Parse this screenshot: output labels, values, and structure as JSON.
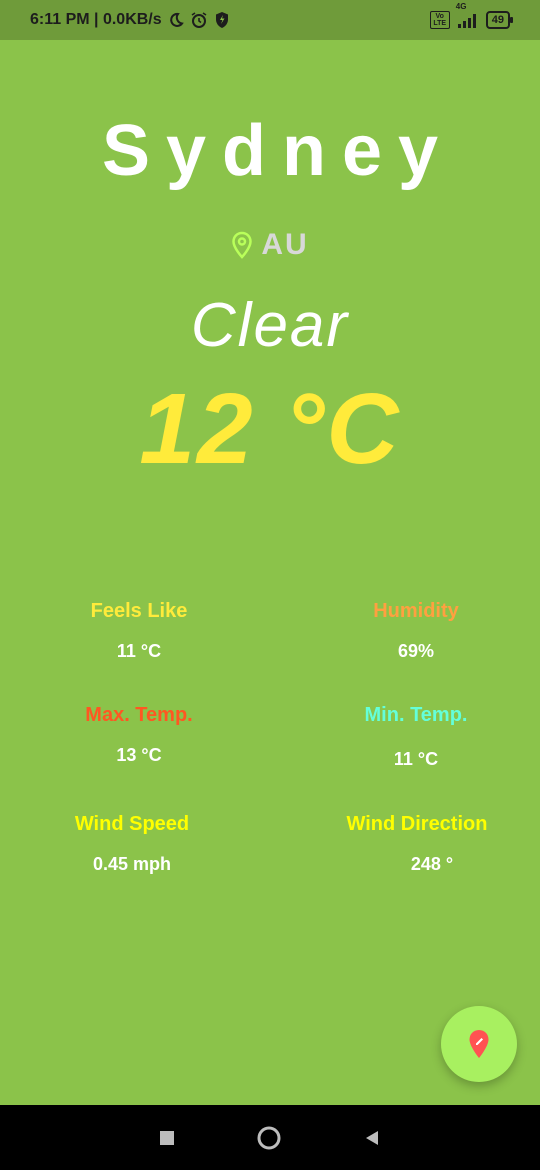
{
  "status_bar": {
    "time_speed": "6:11 PM | 0.0KB/s",
    "network_volte": "Vo LTE",
    "network_type": "4G",
    "battery": "49"
  },
  "location": {
    "city": "Sydney",
    "country": "AU"
  },
  "weather": {
    "description": "Clear",
    "temperature": "12 °C"
  },
  "stats": {
    "feels_like": {
      "label": "Feels Like",
      "value": "11 °C"
    },
    "humidity": {
      "label": "Humidity",
      "value": "69%"
    },
    "max_temp": {
      "label": "Max. Temp.",
      "value": "13 °C"
    },
    "min_temp": {
      "label": "Min. Temp.",
      "value": "11 °C"
    },
    "wind_speed": {
      "label": "Wind Speed",
      "value": "0.45 mph"
    },
    "wind_direction": {
      "label": "Wind Direction",
      "value": "248 °"
    }
  },
  "colors": {
    "background": "#8bc34a",
    "status_bar": "#6f9b3a",
    "temperature": "#ffeb3b",
    "feels_like_label": "#ffeb3b",
    "humidity_label": "#ffa040",
    "max_temp_label": "#ff5722",
    "min_temp_label": "#64ffda",
    "wind_label": "#ffff00",
    "fab": "#a8f060",
    "fab_icon": "#ff5252"
  },
  "icons": {
    "location": "location-pin-icon",
    "fab": "edit-location-icon"
  }
}
